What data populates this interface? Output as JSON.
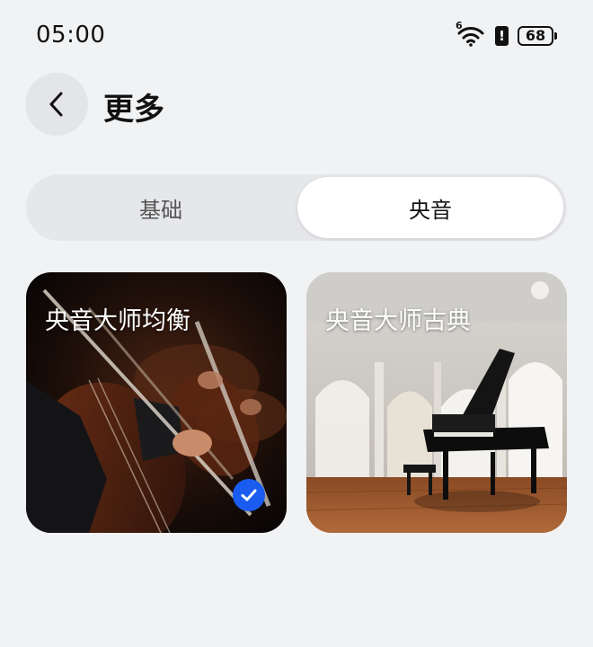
{
  "status_bar": {
    "time": "05:00",
    "network_label": "6",
    "alert_symbol": "!",
    "battery": "68"
  },
  "header": {
    "back_icon": "chevron-left-icon",
    "title": "更多"
  },
  "tabs": [
    {
      "label": "基础",
      "selected": false
    },
    {
      "label": "央音",
      "selected": true
    }
  ],
  "cards": [
    {
      "title": "央音大师均衡",
      "image": "orchestra-cello-photo",
      "selected": true
    },
    {
      "title": "央音大师古典",
      "image": "concert-hall-piano-photo",
      "selected": false
    }
  ],
  "colors": {
    "background": "#f1f2f4",
    "accent": "#1a5cf0",
    "segment_track": "#e6e7ea",
    "segment_active": "#ffffff"
  }
}
